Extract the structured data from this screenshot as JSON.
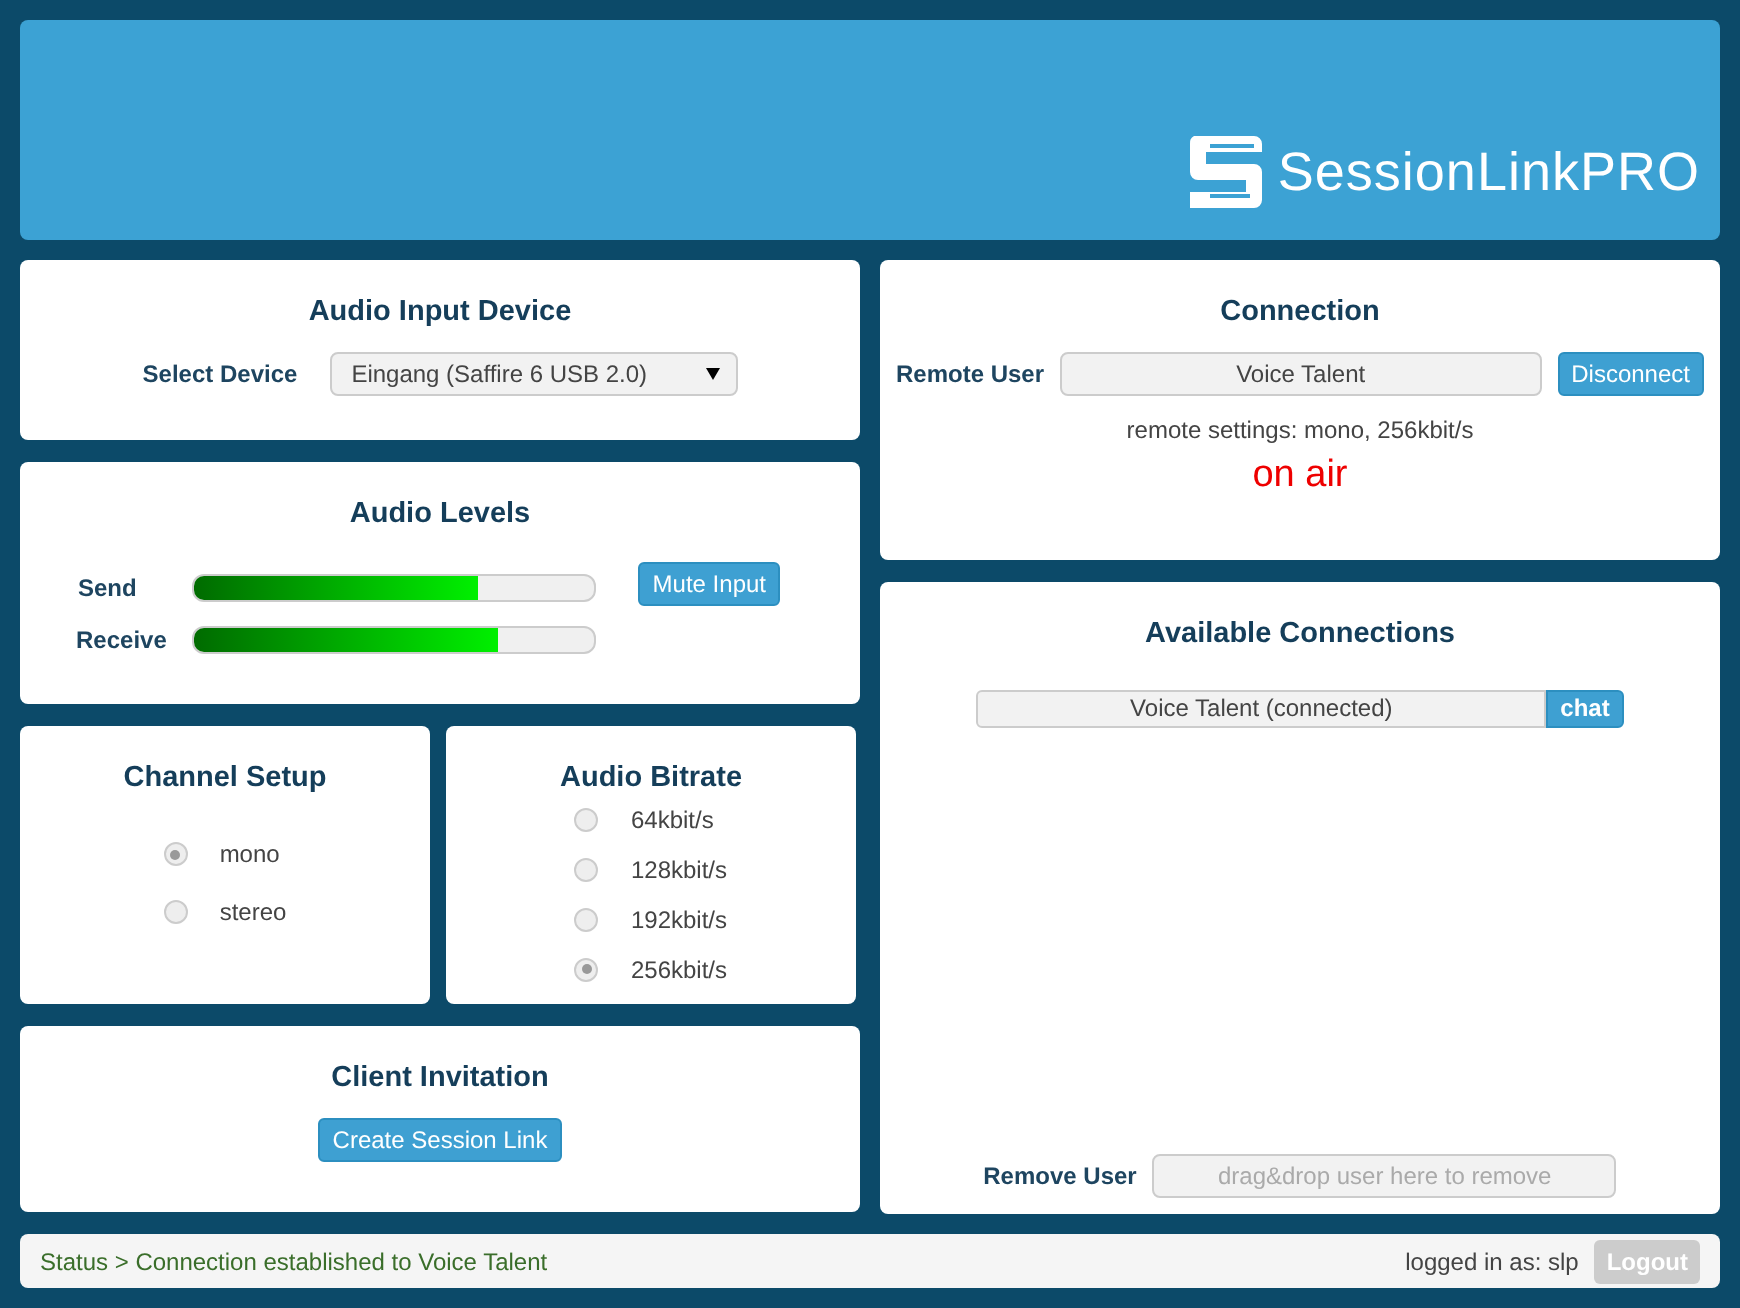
{
  "header": {
    "logo_text": "SessionLinkPRO"
  },
  "audio_input": {
    "title": "Audio Input Device",
    "label": "Select Device",
    "value": "Eingang (Saffire 6 USB 2.0)"
  },
  "audio_levels": {
    "title": "Audio Levels",
    "meters": [
      {
        "label": "Send",
        "level": 0.71
      },
      {
        "label": "Receive",
        "level": 0.76
      }
    ],
    "mute_button": "Mute Input"
  },
  "channel_setup": {
    "title": "Channel Setup",
    "options": [
      {
        "label": "mono",
        "selected": true
      },
      {
        "label": "stereo",
        "selected": false
      }
    ]
  },
  "audio_bitrate": {
    "title": "Audio Bitrate",
    "options": [
      {
        "label": "64kbit/s",
        "selected": false
      },
      {
        "label": "128kbit/s",
        "selected": false
      },
      {
        "label": "192kbit/s",
        "selected": false
      },
      {
        "label": "256kbit/s",
        "selected": true
      }
    ]
  },
  "client_invitation": {
    "title": "Client Invitation",
    "button": "Create Session Link"
  },
  "connection": {
    "title": "Connection",
    "label": "Remote User",
    "value": "Voice Talent",
    "button": "Disconnect",
    "remote_settings": "remote settings: mono, 256kbit/s",
    "status": "on air"
  },
  "available_connections": {
    "title": "Available Connections",
    "users": [
      {
        "name": "Voice Talent (connected)",
        "action": "chat"
      }
    ],
    "remove_label": "Remove User",
    "remove_placeholder": "drag&drop user here to remove"
  },
  "status_bar": {
    "message": "Status > Connection established to Voice Talent",
    "user": "logged in as: slp",
    "logout": {
      "label": "Logout",
      "disabled": true
    }
  }
}
